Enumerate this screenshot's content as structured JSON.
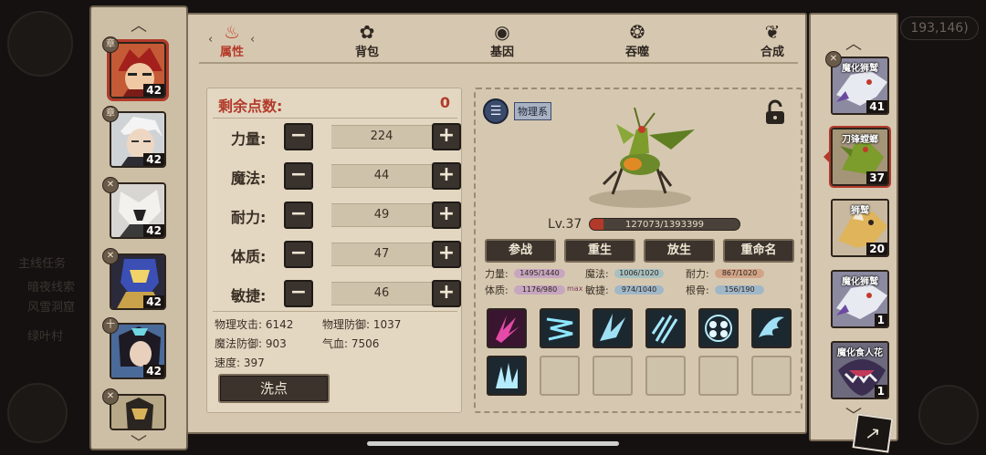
{
  "background": {
    "coords": "193,146)",
    "faded_left": [
      "主线任务",
      "暗夜线索",
      "风雪洞窟",
      "绿叶村"
    ]
  },
  "left_heroes": [
    {
      "level": "42",
      "tag": "章",
      "selected": true
    },
    {
      "level": "42",
      "tag": "章",
      "selected": false
    },
    {
      "level": "42",
      "tag": "✕",
      "selected": false
    },
    {
      "level": "42",
      "tag": "✕",
      "selected": false
    },
    {
      "level": "42",
      "tag": "十",
      "selected": false
    },
    {
      "level": "",
      "tag": "✕",
      "selected": false
    }
  ],
  "tabs": [
    {
      "label": "属性",
      "icon": "flame-icon",
      "active": true
    },
    {
      "label": "背包",
      "icon": "bag-icon",
      "active": false
    },
    {
      "label": "基因",
      "icon": "gene-icon",
      "active": false
    },
    {
      "label": "吞噬",
      "icon": "devour-icon",
      "active": false
    },
    {
      "label": "合成",
      "icon": "synthesis-icon",
      "active": false
    }
  ],
  "stats": {
    "remaining_label": "剩余点数:",
    "remaining_value": "0",
    "attributes": [
      {
        "label": "力量:",
        "value": "224"
      },
      {
        "label": "魔法:",
        "value": "44"
      },
      {
        "label": "耐力:",
        "value": "49"
      },
      {
        "label": "体质:",
        "value": "47"
      },
      {
        "label": "敏捷:",
        "value": "46"
      }
    ],
    "derived": {
      "phys_atk": "物理攻击: 6142",
      "phys_def": "物理防御: 1037",
      "magic_def": "魔法防御: 903",
      "hp": "气血: 7506",
      "speed": "速度: 397"
    },
    "reset_label": "洗点"
  },
  "creature": {
    "type_badge": "物理系",
    "level": "Lv.37",
    "exp_text": "127073/1393399",
    "exp_fraction": 0.091,
    "actions": [
      "参战",
      "重生",
      "放生",
      "重命名"
    ],
    "growth": [
      {
        "label": "力量:",
        "value": "1495/1440",
        "color": "#c7a6c0"
      },
      {
        "label": "魔法:",
        "value": "1006/1020",
        "color": "#a7c0c0"
      },
      {
        "label": "耐力:",
        "value": "867/1020",
        "color": "#d2a487"
      },
      {
        "label": "体质:",
        "value": "1176/980",
        "color": "#c7a6c0",
        "suffix": "max"
      },
      {
        "label": "敏捷:",
        "value": "974/1040",
        "color": "#a0b7c8"
      },
      {
        "label": "根骨:",
        "value": "156/190",
        "color": "#a0b7c8"
      }
    ],
    "skills": [
      "claw-icon",
      "slash-icon",
      "blade-icon",
      "scratch-icon",
      "orb-icon",
      "wing-icon",
      "ice-claw-icon"
    ]
  },
  "right_monsters": [
    {
      "name": "魔化狮鹫",
      "level": "41",
      "selected": false,
      "tag": "✕"
    },
    {
      "name": "刀锋螳螂",
      "level": "37",
      "selected": true,
      "tag": ""
    },
    {
      "name": "狮鹫",
      "level": "20",
      "selected": false,
      "tag": ""
    },
    {
      "name": "魔化狮鹫",
      "level": "1",
      "selected": false,
      "tag": ""
    },
    {
      "name": "魔化食人花",
      "level": "1",
      "selected": false,
      "tag": ""
    }
  ]
}
